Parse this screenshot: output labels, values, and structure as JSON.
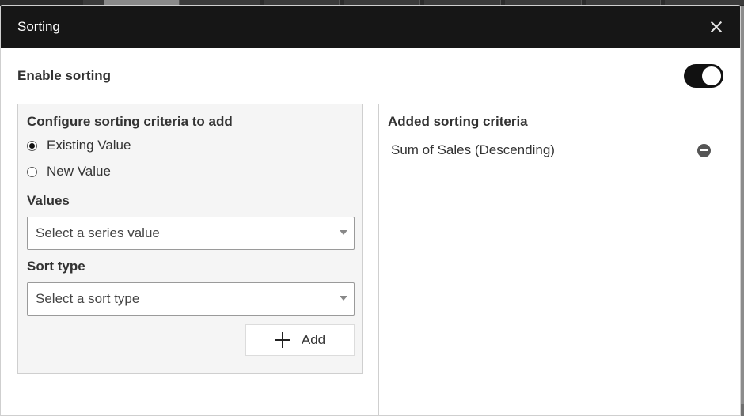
{
  "dialog": {
    "title": "Sorting",
    "close_icon": "close-icon"
  },
  "enable_sorting": {
    "label": "Enable sorting",
    "enabled": true
  },
  "configure_panel": {
    "title": "Configure sorting criteria to add",
    "radio_options": [
      {
        "label": "Existing Value",
        "checked": true
      },
      {
        "label": "New Value",
        "checked": false
      }
    ],
    "values_field": {
      "label": "Values",
      "placeholder": "Select a series value"
    },
    "sort_type_field": {
      "label": "Sort type",
      "placeholder": "Select a sort type"
    },
    "add_button": {
      "label": "Add",
      "icon": "plus-icon"
    }
  },
  "added_panel": {
    "title": "Added sorting criteria",
    "items": [
      {
        "label": "Sum of Sales (Descending)",
        "icon": "remove-icon"
      }
    ]
  }
}
